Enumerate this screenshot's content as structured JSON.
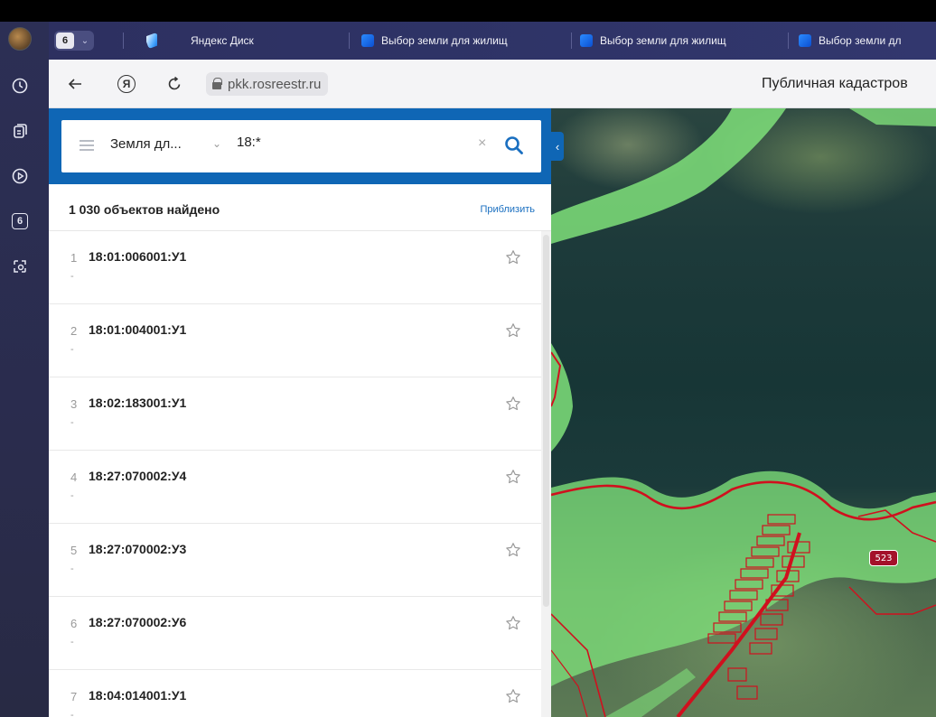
{
  "browser": {
    "tab_count": "6",
    "tabs": [
      {
        "label": "Яндекс Диск"
      },
      {
        "label": "Выбор земли для жилищ"
      },
      {
        "label": "Выбор земли для жилищ"
      },
      {
        "label": "Выбор земли дл"
      }
    ],
    "rail_badge": "6",
    "url": "pkk.rosreestr.ru",
    "page_title": "Публичная кадастров"
  },
  "search": {
    "layer": "Земля дл...",
    "query": "18:*"
  },
  "results": {
    "count_text": "1 030 объектов найдено",
    "zoom_label": "Приблизить",
    "items": [
      {
        "index": "1",
        "code": "18:01:006001:У1",
        "sub": "-"
      },
      {
        "index": "2",
        "code": "18:01:004001:У1",
        "sub": "-"
      },
      {
        "index": "3",
        "code": "18:02:183001:У1",
        "sub": "-"
      },
      {
        "index": "4",
        "code": "18:27:070002:У4",
        "sub": "-"
      },
      {
        "index": "5",
        "code": "18:27:070002:У3",
        "sub": "-"
      },
      {
        "index": "6",
        "code": "18:27:070002:У6",
        "sub": "-"
      },
      {
        "index": "7",
        "code": "18:04:014001:У1",
        "sub": "-"
      }
    ]
  },
  "map": {
    "parcel_label": "523"
  },
  "colors": {
    "header_blue": "#0f66b5",
    "link_blue": "#1a6fc0",
    "zone_green": "#7fe07a",
    "boundary_red": "#d0101e"
  }
}
